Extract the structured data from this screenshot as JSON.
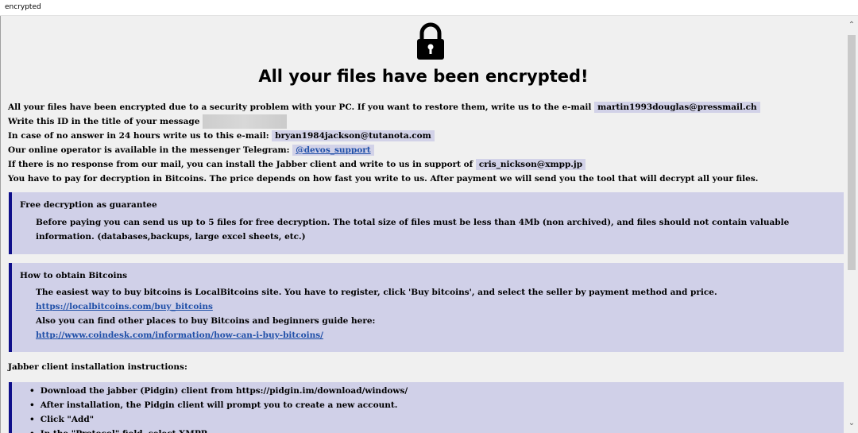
{
  "window": {
    "title": "encrypted"
  },
  "header": {
    "icon": "lock-icon",
    "heading": "All your files have been encrypted!"
  },
  "intro": {
    "line1_text": "All your files have been encrypted due to a security problem with your PC. If you want to restore them, write us to the e-mail",
    "line1_email": "martin1993douglas@pressmail.ch",
    "line2_text": "Write this ID in the title of your message",
    "line3_text": "In case of no answer in 24 hours write us to this e-mail:",
    "line3_email": "bryan1984jackson@tutanota.com",
    "line4_text": "Our online operator is available in the messenger Telegram:",
    "line4_handle": "@devos_support",
    "line5_text": "If there is no response from our mail, you can install the Jabber client and write to us in support of",
    "line5_jabber": "cris_nickson@xmpp.jp",
    "line6_text": "You have to pay for decryption in Bitcoins. The price depends on how fast you write to us. After payment we will send you the tool that will decrypt all your files."
  },
  "free_decryption": {
    "title": "Free decryption as guarantee",
    "text": "Before paying you can send us up to 5 files for free decryption. The total size of files must be less than 4Mb (non archived), and files should not contain valuable information. (databases,backups, large excel sheets, etc.)"
  },
  "bitcoins": {
    "title": "How to obtain Bitcoins",
    "text1": "The easiest way to buy bitcoins is LocalBitcoins site. You have to register, click 'Buy bitcoins', and select the seller by payment method and price.",
    "link1": "https://localbitcoins.com/buy_bitcoins",
    "text2": "Also you can find other places to buy Bitcoins and beginners guide here:",
    "link2": "http://www.coindesk.com/information/how-can-i-buy-bitcoins/"
  },
  "jabber": {
    "label": "Jabber client installation instructions:",
    "steps": [
      "Download the jabber (Pidgin) client from https://pidgin.im/download/windows/",
      "After installation, the Pidgin client will prompt you to create a new account.",
      "Click \"Add\"",
      "In the \"Protocol\" field, select XMPP"
    ]
  }
}
